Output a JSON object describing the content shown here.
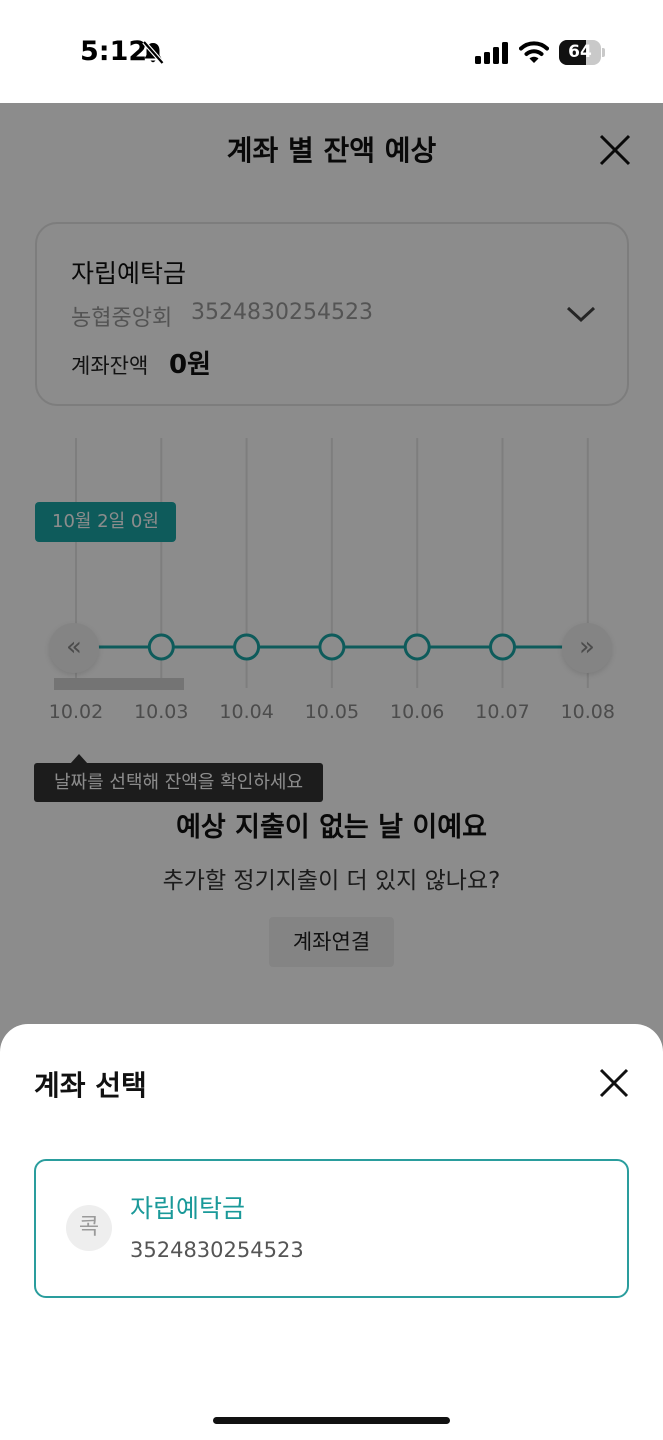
{
  "status_bar": {
    "time": "5:12",
    "battery": "64",
    "battery_level_percent": 64,
    "icons": [
      "bell-slash-icon",
      "signal-icon",
      "wifi-icon",
      "battery-icon"
    ]
  },
  "screen": {
    "title": "계좌 별 잔액 예상",
    "account": {
      "name": "자립예탁금",
      "bank": "농협중앙회",
      "number": "3524830254523",
      "balance_label": "계좌잔액",
      "balance_value": "0원"
    },
    "timeline": {
      "selected_tooltip": "10월 2일 0원",
      "prev_glyph": "«",
      "next_glyph": "»",
      "dates": [
        "10.02",
        "10.03",
        "10.04",
        "10.05",
        "10.06",
        "10.07",
        "10.08"
      ],
      "accent_color": "#1aa7a7"
    },
    "hint": "날짜를 선택해 잔액을 확인하세요",
    "empty_title": "예상 지출이 없는 날 이예요",
    "empty_subtitle": "추가할 정기지출이 더 있지 않나요?",
    "connect_button": "계좌연결"
  },
  "sheet": {
    "title": "계좌 선택",
    "option": {
      "logo_glyph": "콕",
      "name": "자립예탁금",
      "number": "3524830254523",
      "accent_color": "#1a9999"
    }
  }
}
